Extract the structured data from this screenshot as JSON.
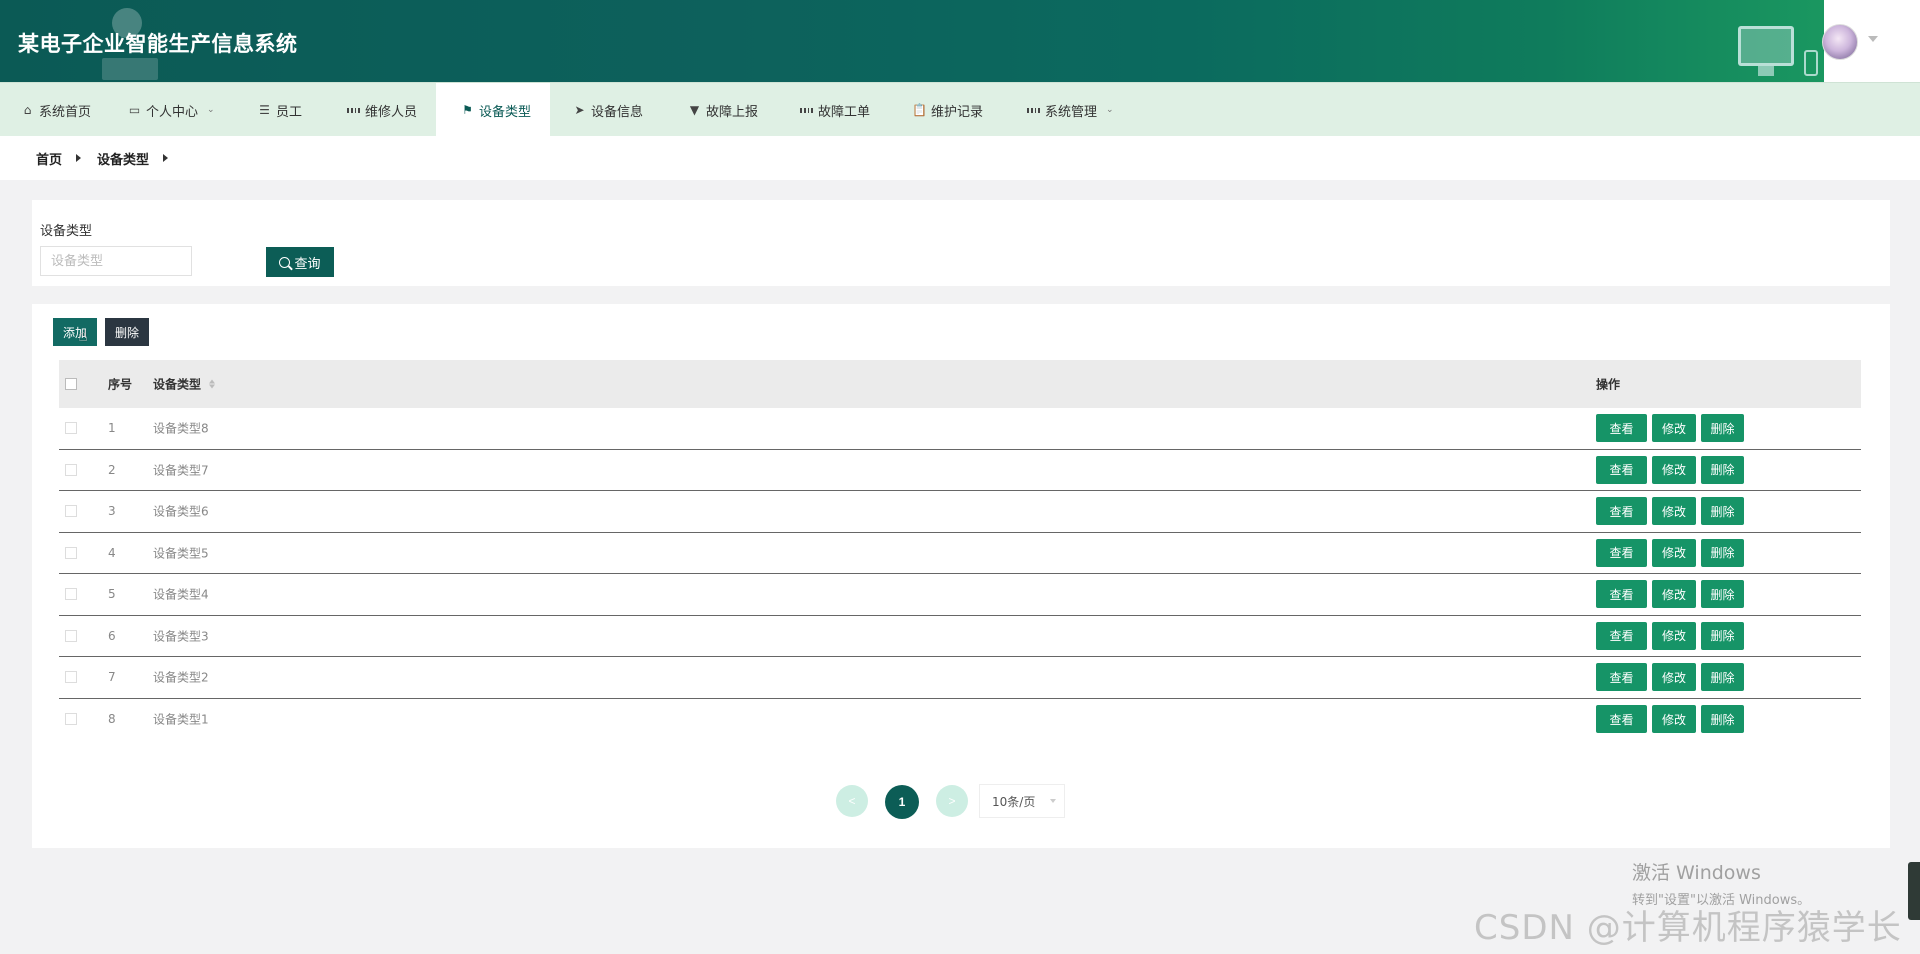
{
  "header": {
    "title": "某电子企业智能生产信息系统"
  },
  "nav": {
    "items": [
      {
        "label": "系统首页",
        "icon": "home-icon"
      },
      {
        "label": "个人中心",
        "icon": "calendar-icon",
        "has_dropdown": true
      },
      {
        "label": "员工",
        "icon": "list-icon"
      },
      {
        "label": "维修人员",
        "icon": "grid-icon"
      },
      {
        "label": "设备类型",
        "icon": "flag-icon",
        "active": true
      },
      {
        "label": "设备信息",
        "icon": "send-icon"
      },
      {
        "label": "故障上报",
        "icon": "pin-icon"
      },
      {
        "label": "故障工单",
        "icon": "grid-icon"
      },
      {
        "label": "维护记录",
        "icon": "clipboard-icon"
      },
      {
        "label": "系统管理",
        "icon": "grid-icon",
        "has_dropdown": true
      }
    ]
  },
  "breadcrumb": {
    "items": [
      "首页",
      "设备类型"
    ]
  },
  "search": {
    "label": "设备类型",
    "placeholder": "设备类型",
    "value": "",
    "button_label": "查询"
  },
  "toolbar": {
    "add_label": "添加",
    "delete_label": "删除"
  },
  "table": {
    "columns": [
      "序号",
      "设备类型",
      "操作"
    ],
    "rows": [
      {
        "index": "1",
        "name": "设备类型8"
      },
      {
        "index": "2",
        "name": "设备类型7"
      },
      {
        "index": "3",
        "name": "设备类型6"
      },
      {
        "index": "4",
        "name": "设备类型5"
      },
      {
        "index": "5",
        "name": "设备类型4"
      },
      {
        "index": "6",
        "name": "设备类型3"
      },
      {
        "index": "7",
        "name": "设备类型2"
      },
      {
        "index": "8",
        "name": "设备类型1"
      }
    ],
    "row_actions": {
      "view": "查看",
      "edit": "修改",
      "delete": "删除"
    }
  },
  "pagination": {
    "prev": "<",
    "current_page": "1",
    "next": ">",
    "page_size": "10条/页"
  },
  "overlay": {
    "activate_title": "激活 Windows",
    "activate_sub": "转到\"设置\"以激活 Windows。",
    "watermark": "CSDN @计算机程序猿学长"
  },
  "colors": {
    "primary": "#0c5d56",
    "action_green": "#169467",
    "nav_bg": "#dff0e4",
    "dark_button": "#2b3641"
  }
}
